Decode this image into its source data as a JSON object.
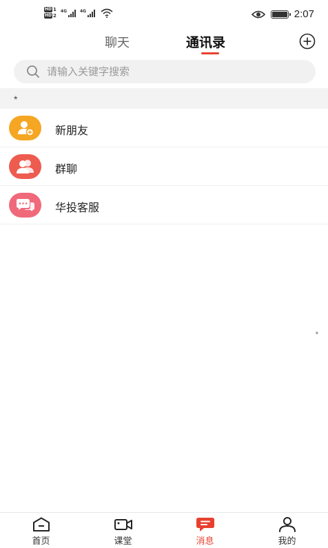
{
  "status_bar": {
    "hd1": "HD",
    "hd1_num": "1",
    "hd2": "HD",
    "hd2_num": "2",
    "net1": "4G",
    "net2": "4G",
    "time": "2:07"
  },
  "header": {
    "tabs": [
      {
        "label": "聊天",
        "active": false
      },
      {
        "label": "通讯录",
        "active": true
      }
    ],
    "add_icon": "plus-circle-icon"
  },
  "search": {
    "placeholder": "请输入关键字搜索",
    "value": ""
  },
  "section": {
    "letter": "*"
  },
  "contacts": [
    {
      "label": "新朋友",
      "icon": "add-friend-icon",
      "color": "#f5a623"
    },
    {
      "label": "群聊",
      "icon": "group-icon",
      "color": "#ee5b4f"
    },
    {
      "label": "华投客服",
      "icon": "chat-bubbles-icon",
      "color": "#f0697b"
    }
  ],
  "side_index": {
    "mark": "*"
  },
  "bottom_nav": {
    "items": [
      {
        "label": "首页",
        "icon": "home-icon",
        "active": false
      },
      {
        "label": "课堂",
        "icon": "video-camera-icon",
        "active": false
      },
      {
        "label": "消息",
        "icon": "message-icon",
        "active": true
      },
      {
        "label": "我的",
        "icon": "user-icon",
        "active": false
      }
    ]
  },
  "colors": {
    "accent": "#e8402f",
    "new_friend": "#f5a623",
    "group": "#ee5b4f",
    "service": "#f0697b"
  }
}
